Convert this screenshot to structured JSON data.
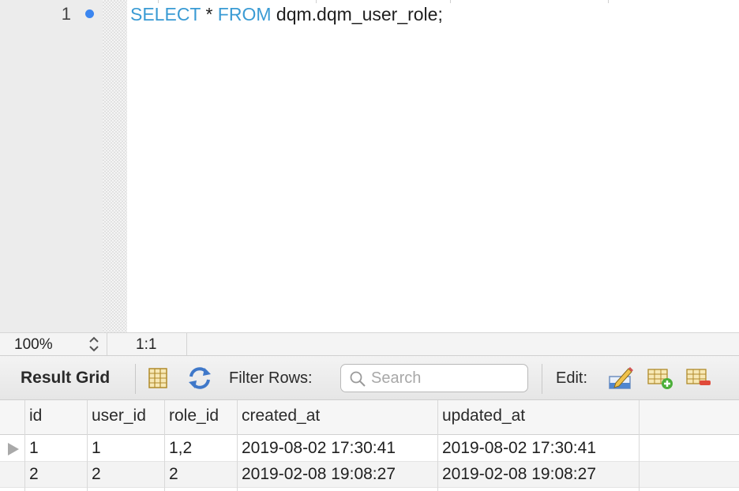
{
  "editor": {
    "line_number": "1",
    "code": {
      "kw_select": "SELECT",
      "star": " * ",
      "kw_from": "FROM",
      "rest": " dqm.dqm_user_role;"
    },
    "keyword_color": "#3a9bd4"
  },
  "status_bar": {
    "zoom": "100%",
    "cursor_position": "1:1"
  },
  "toolbar": {
    "result_grid_label": "Result Grid",
    "filter_label": "Filter Rows:",
    "search_placeholder": "Search",
    "edit_label": "Edit:",
    "icons": [
      "form-editor-icon",
      "refresh-icon",
      "search-icon",
      "edit-row-icon",
      "add-row-icon",
      "delete-row-icon"
    ]
  },
  "grid": {
    "columns": [
      "id",
      "user_id",
      "role_id",
      "created_at",
      "updated_at"
    ],
    "rows": [
      [
        "1",
        "1",
        "1,2",
        "2019-08-02 17:30:41",
        "2019-08-02 17:30:41"
      ],
      [
        "2",
        "2",
        "2",
        "2019-02-08 19:08:27",
        "2019-02-08 19:08:27"
      ]
    ]
  }
}
